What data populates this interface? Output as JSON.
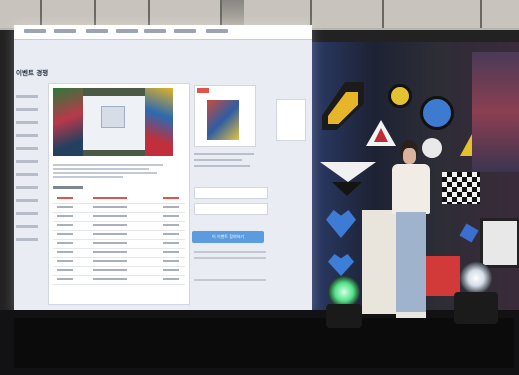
{
  "screen": {
    "title": "이벤트 경쟁",
    "button_label": "이 이벤트 참여하기"
  },
  "colors": {
    "screen_bg": "#e9edf3",
    "accent_red": "#e2534a",
    "accent_blue": "#5b9be0",
    "mural_bg": "#2c2a33"
  }
}
